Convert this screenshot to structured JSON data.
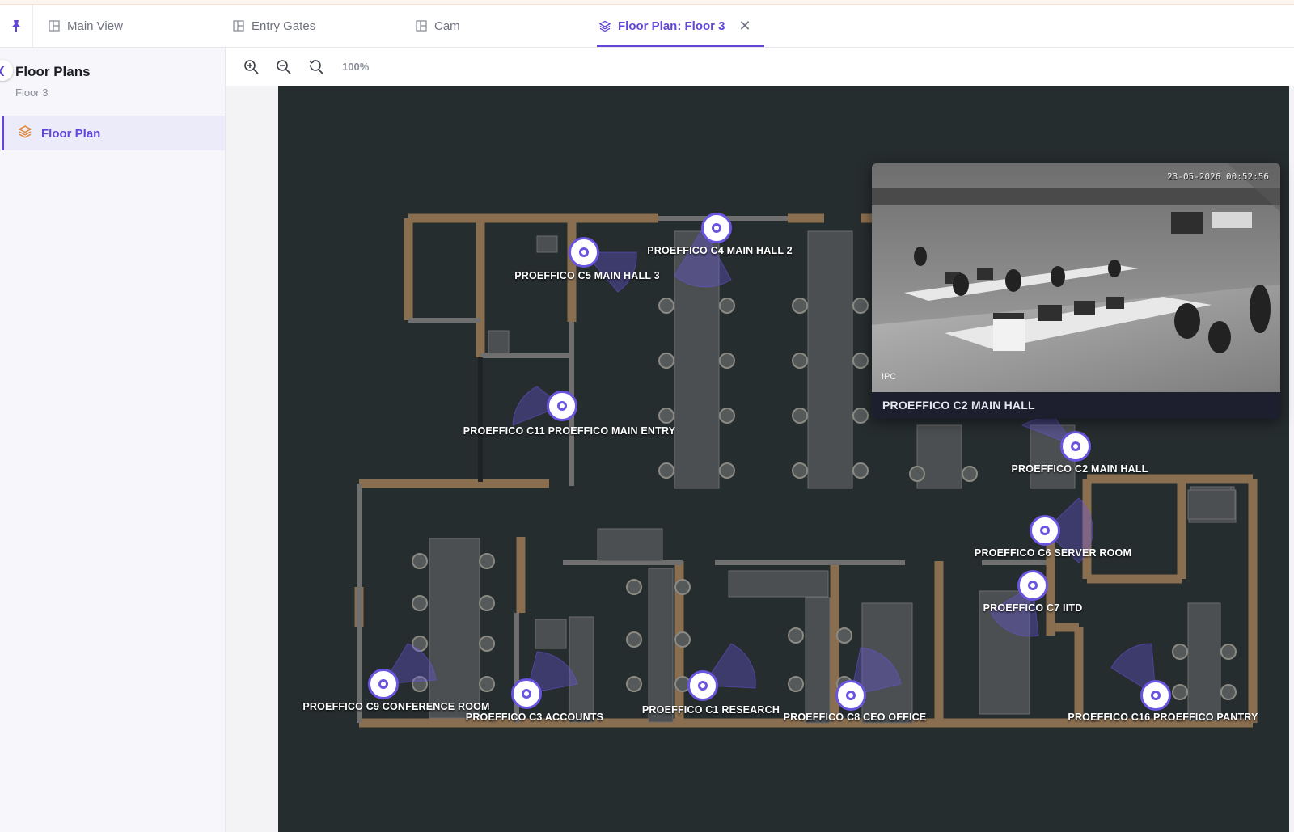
{
  "tabs": [
    {
      "label": "Main View",
      "icon": "layout-icon"
    },
    {
      "label": "Entry Gates",
      "icon": "layout-icon"
    },
    {
      "label": "Cam",
      "icon": "layout-icon"
    },
    {
      "label": "Floor Plan: Floor 3",
      "icon": "layers-icon",
      "active": true
    }
  ],
  "sidebar": {
    "title": "Floor Plans",
    "subtitle": "Floor 3",
    "items": [
      {
        "label": "Floor Plan",
        "icon": "layers-icon",
        "active": true
      }
    ]
  },
  "toolbar": {
    "zoom_level": "100%"
  },
  "cameras": [
    {
      "label": "PROEFFICO C4 MAIN HALL 2"
    },
    {
      "label": "PROEFFICO C5 MAIN HALL 3"
    },
    {
      "label": "PROEFFICO C11 PROEFFICO MAIN ENTRY"
    },
    {
      "label": "PROEFFICO C2 MAIN HALL"
    },
    {
      "label": "PROEFFICO C6  SERVER ROOM"
    },
    {
      "label": "PROEFFICO C7 IITD"
    },
    {
      "label": "PROEFFICO C9 CONFERENCE ROOM"
    },
    {
      "label": "PROEFFICO C3 ACCOUNTS"
    },
    {
      "label": "PROEFFICO C1 RESEARCH"
    },
    {
      "label": "PROEFFICO C8 CEO OFFICE"
    },
    {
      "label": "PROEFFICO C16 PROEFFICO PANTRY"
    }
  ],
  "popup": {
    "title": "PROEFFICO C2 MAIN HALL",
    "timestamp": "23-05-2026 00:52:56",
    "overlay": "IPC"
  },
  "colors": {
    "accent": "#6246d8",
    "map_bg": "#262d2f",
    "wall": "#8a6e50",
    "camera_ring": "#6a55e0"
  }
}
